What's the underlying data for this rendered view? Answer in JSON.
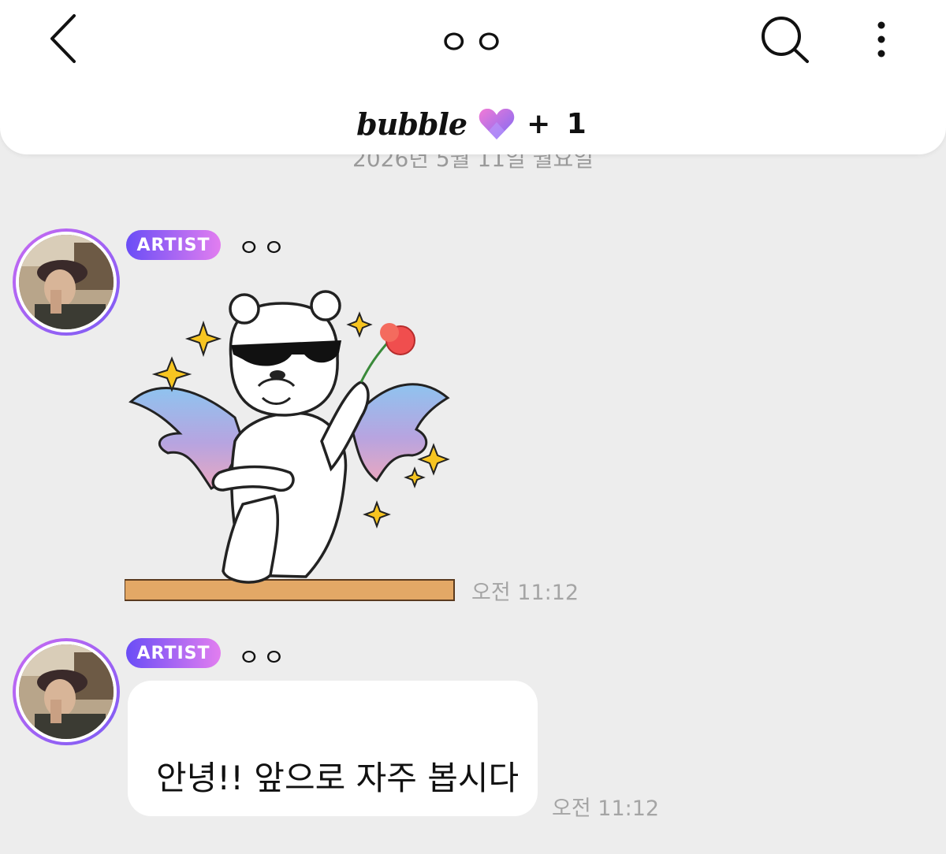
{
  "header": {
    "title": "ㅇㅇ",
    "brand": "bubble",
    "member_count": "+ 1"
  },
  "date_separator": "2026년 5월 11일 월요일",
  "messages": [
    {
      "badge": "ARTIST",
      "sender": "ㅇㅇ",
      "type": "sticker",
      "time": "오전 11:12"
    },
    {
      "badge": "ARTIST",
      "sender": "ㅇㅇ",
      "type": "text",
      "text": "안녕!! 앞으로 자주 봅시다",
      "time": "오전 11:12"
    }
  ],
  "colors": {
    "background": "#ededed",
    "badge_start": "#6a4df6",
    "badge_end": "#e27ef0",
    "timestamp": "#a5a5a5"
  },
  "icons": [
    "back-arrow-icon",
    "search-icon",
    "more-vertical-icon",
    "heart-icon"
  ]
}
